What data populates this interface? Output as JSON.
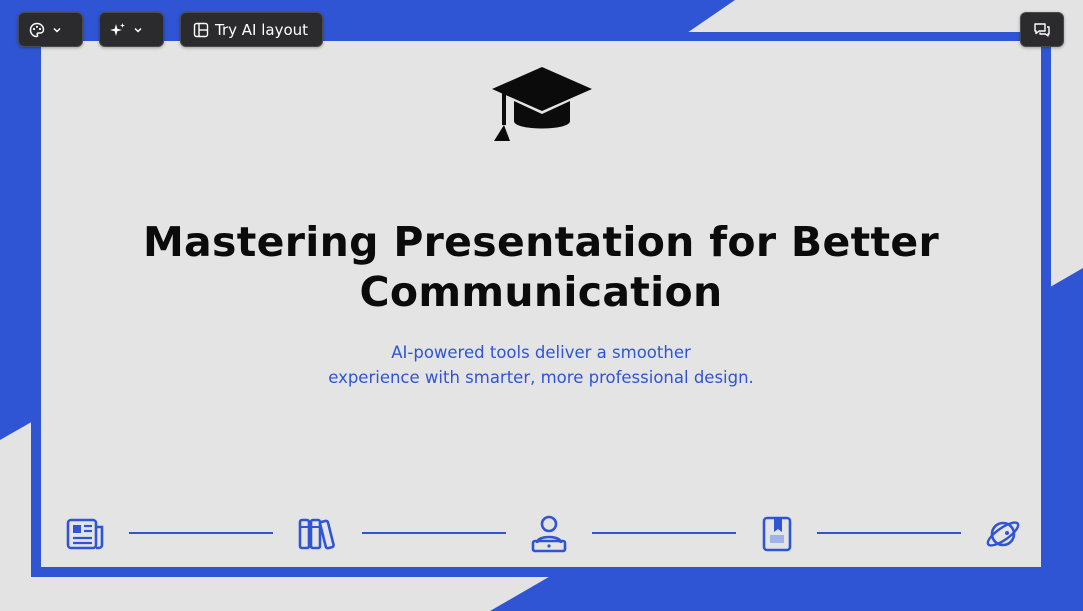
{
  "toolbar": {
    "theme_icon": "palette-icon",
    "magic_icon": "sparkles-icon",
    "layout_icon": "layout-icon",
    "try_ai_label": "Try AI layout",
    "comments_icon": "comments-icon"
  },
  "slide": {
    "hero_icon": "graduation-cap-icon",
    "title": "Mastering Presentation for Better Communication",
    "subtitle_lines": [
      "AI-powered tools deliver a smoother",
      "experience with smarter, more professional design."
    ],
    "footer_icons": [
      "newspaper-icon",
      "books-icon",
      "person-laptop-icon",
      "book-bookmark-icon",
      "planet-icon"
    ]
  },
  "colors": {
    "accent": "#2f55d4",
    "slide_background": "#e4e4e4",
    "title": "#0b0b0b",
    "toolbar_button": "#2b2b2e"
  }
}
